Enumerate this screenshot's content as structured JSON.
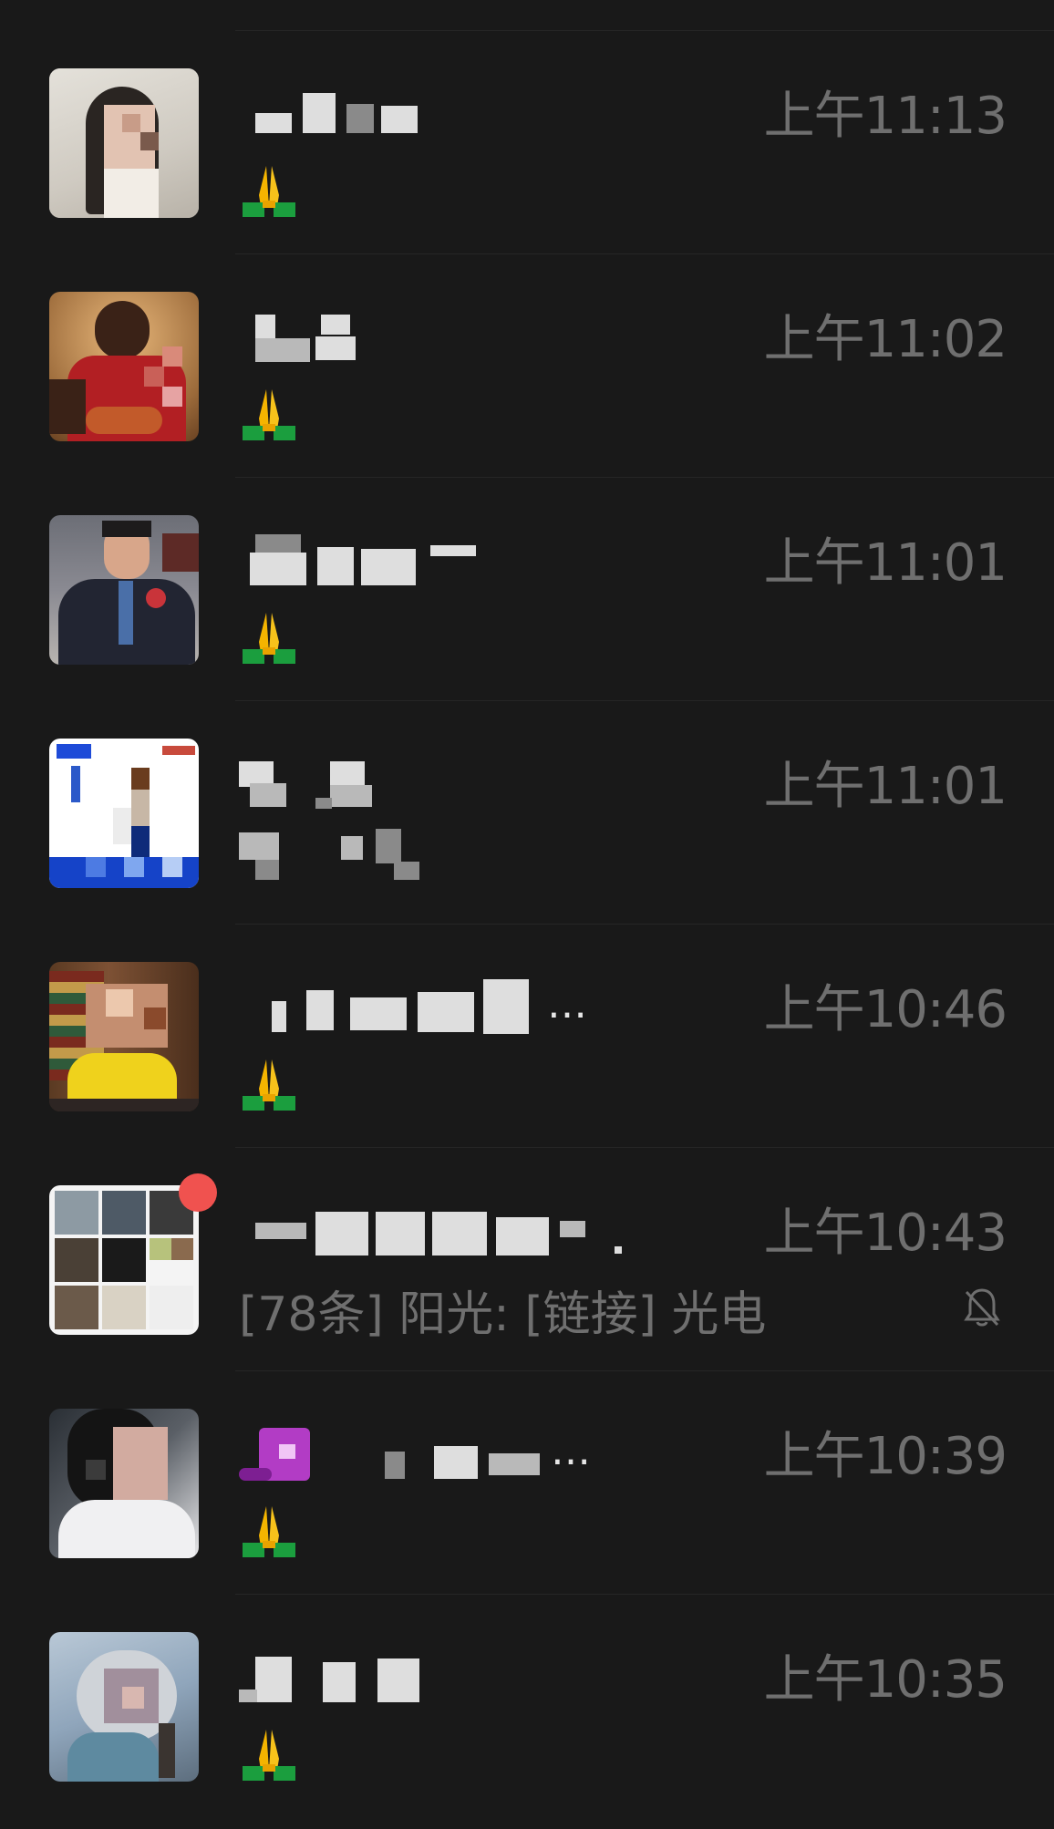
{
  "chats": [
    {
      "time": "上午11:13",
      "preview": "🙏",
      "avatar": "photo-woman"
    },
    {
      "time": "上午11:02",
      "preview": "🙏",
      "avatar": "photo-basketball-player"
    },
    {
      "time": "上午11:01",
      "preview": "🙏",
      "avatar": "photo-man-suit"
    },
    {
      "time": "上午11:01",
      "preview": "",
      "avatar": "poster-blue"
    },
    {
      "time": "上午10:46",
      "preview": "🙏",
      "avatar": "photo-woman-yellow",
      "name_suffix": "…"
    },
    {
      "time": "上午10:43",
      "preview": "[78条] 阳光: [链接] 光电",
      "avatar": "group-grid",
      "muted": true,
      "unread": true
    },
    {
      "time": "上午10:39",
      "preview": "🙏",
      "avatar": "photo-woman-white",
      "name_suffix": "…"
    },
    {
      "time": "上午10:35",
      "preview": "🙏",
      "avatar": "anime-girl"
    }
  ],
  "colors": {
    "background": "#191919",
    "time_text": "#6f6f6f",
    "name_text": "#e6e6e6",
    "unread_badge": "#f0524f"
  }
}
